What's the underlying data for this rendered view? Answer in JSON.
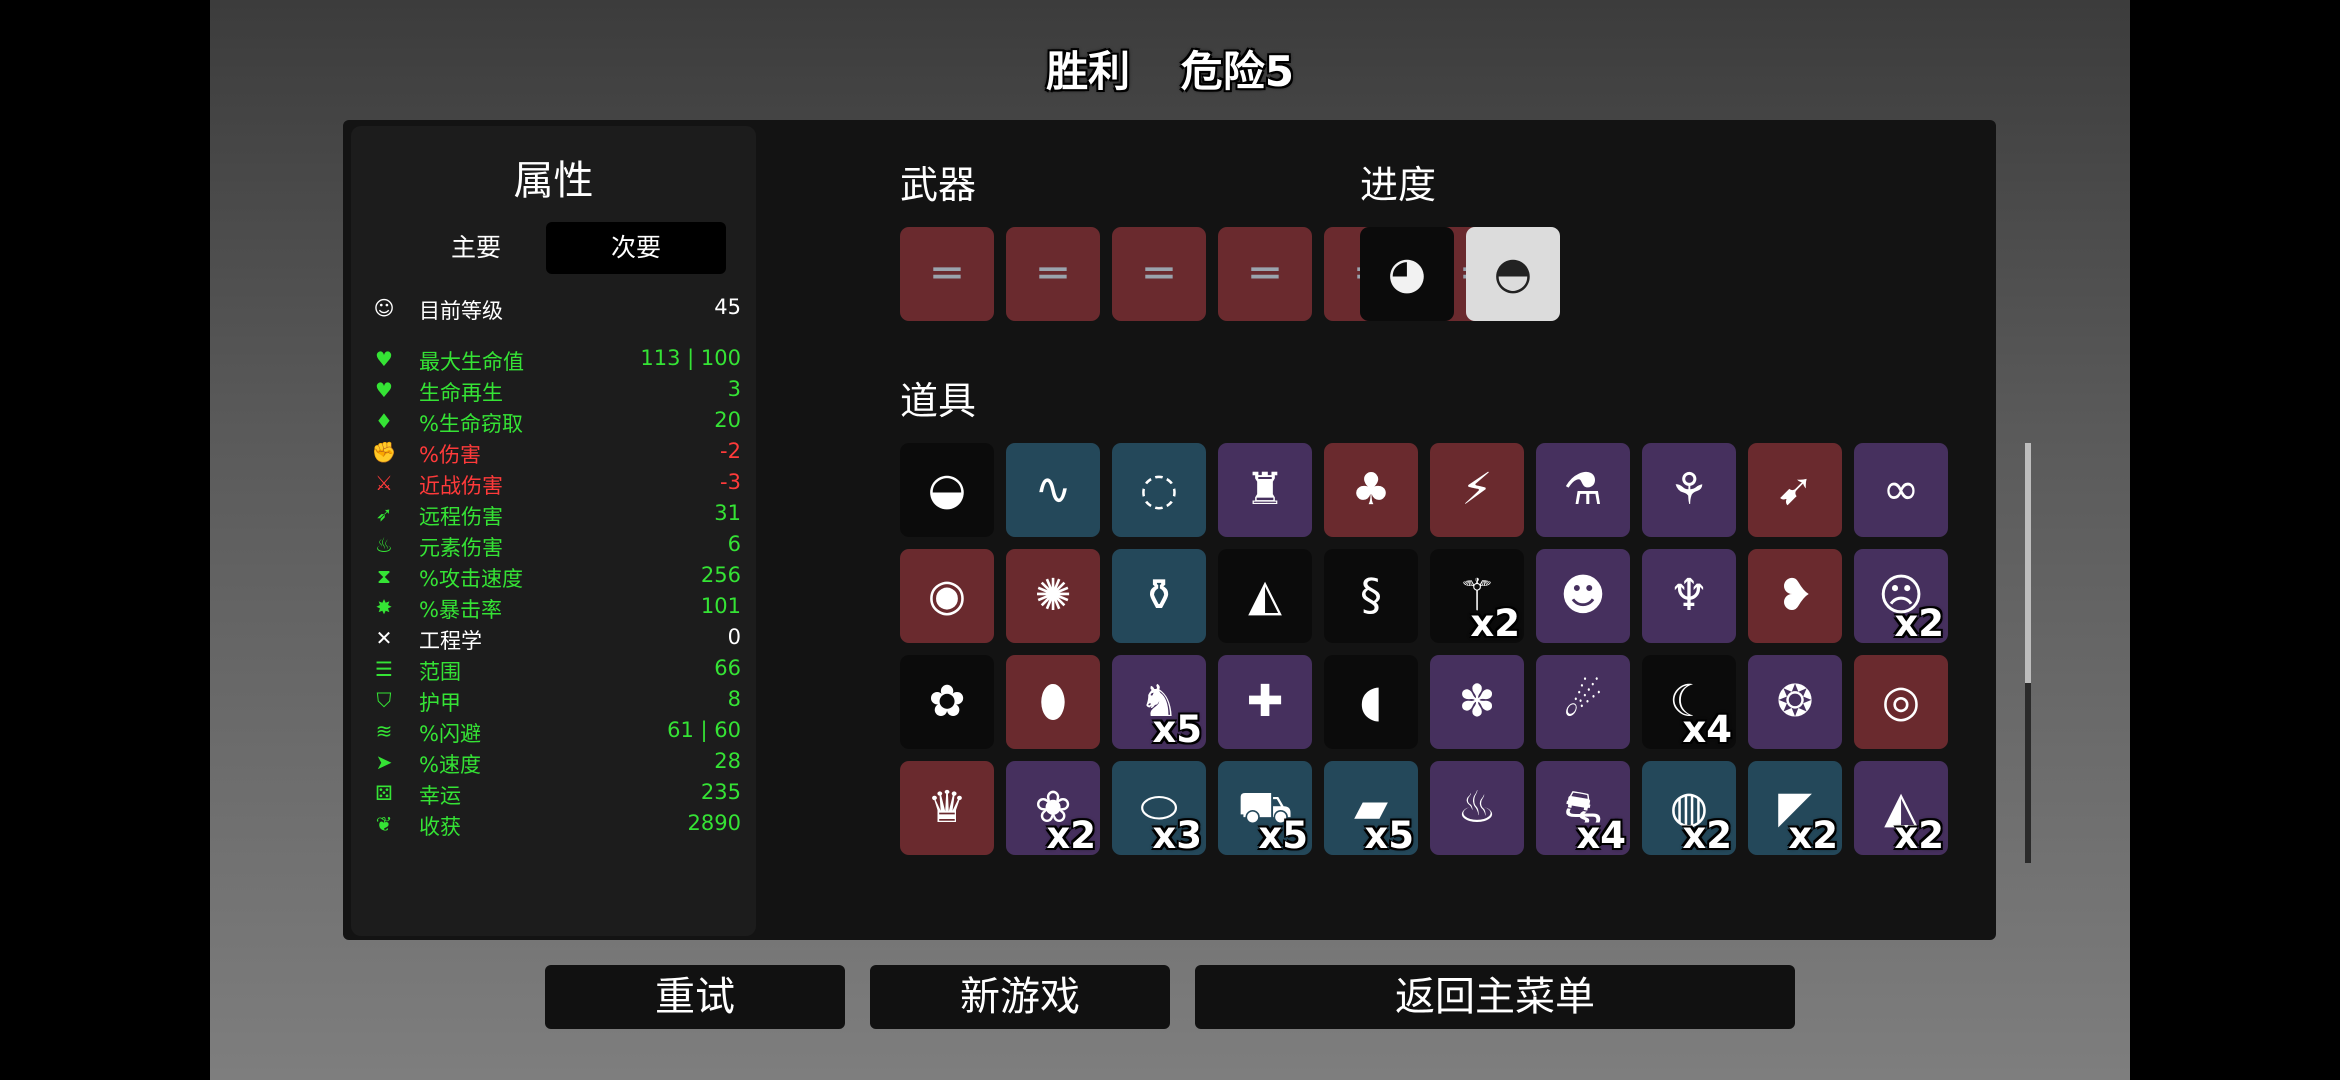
{
  "header": {
    "result": "胜利",
    "difficulty": "危险5"
  },
  "stats_panel": {
    "title": "属性",
    "tabs": [
      {
        "label": "主要",
        "active": false
      },
      {
        "label": "次要",
        "active": true
      }
    ],
    "level": {
      "label": "目前等级",
      "value": "45",
      "icon": "egg-face-icon"
    },
    "rows": [
      {
        "label": "最大生命值",
        "value": "113 | 100",
        "color": "#35e335",
        "icon": "heart-icon",
        "glyph": "♥"
      },
      {
        "label": "生命再生",
        "value": "3",
        "color": "#35e335",
        "icon": "regen-heart-icon",
        "glyph": "♥"
      },
      {
        "label": "%生命窃取",
        "value": "20",
        "color": "#35e335",
        "icon": "fangs-icon",
        "glyph": "♦"
      },
      {
        "label": "%伤害",
        "value": "-2",
        "color": "#ff3a3a",
        "icon": "fist-icon",
        "glyph": "✊"
      },
      {
        "label": "近战伤害",
        "value": "-3",
        "color": "#ff3a3a",
        "icon": "sword-icon",
        "glyph": "⚔"
      },
      {
        "label": "远程伤害",
        "value": "31",
        "color": "#35e335",
        "icon": "bow-icon",
        "glyph": "➶"
      },
      {
        "label": "元素伤害",
        "value": "6",
        "color": "#35e335",
        "icon": "flame-icon",
        "glyph": "♨"
      },
      {
        "label": "%攻击速度",
        "value": "256",
        "color": "#35e335",
        "icon": "hourglass-icon",
        "glyph": "⧗"
      },
      {
        "label": "%暴击率",
        "value": "101",
        "color": "#35e335",
        "icon": "crit-burst-icon",
        "glyph": "✸"
      },
      {
        "label": "工程学",
        "value": "0",
        "color": "#ffffff",
        "icon": "wrench-icon",
        "glyph": "✕"
      },
      {
        "label": "范围",
        "value": "66",
        "color": "#35e335",
        "icon": "range-waves-icon",
        "glyph": "☰"
      },
      {
        "label": "护甲",
        "value": "8",
        "color": "#35e335",
        "icon": "shield-icon",
        "glyph": "⛉"
      },
      {
        "label": "%闪避",
        "value": "61 | 60",
        "color": "#35e335",
        "icon": "dodge-wind-icon",
        "glyph": "≋"
      },
      {
        "label": "%速度",
        "value": "28",
        "color": "#35e335",
        "icon": "boot-icon",
        "glyph": "➤"
      },
      {
        "label": "幸运",
        "value": "235",
        "color": "#35e335",
        "icon": "dice-icon",
        "glyph": "⚄"
      },
      {
        "label": "收获",
        "value": "2890",
        "color": "#35e335",
        "icon": "wheat-icon",
        "glyph": "❦"
      }
    ]
  },
  "weapons": {
    "title": "武器",
    "slots": [
      {
        "icon": "double-barrel-shotgun-icon",
        "glyph": "═",
        "bg": "#6a2a2e"
      },
      {
        "icon": "double-barrel-shotgun-icon",
        "glyph": "═",
        "bg": "#6a2a2e"
      },
      {
        "icon": "double-barrel-shotgun-icon",
        "glyph": "═",
        "bg": "#6a2a2e"
      },
      {
        "icon": "double-barrel-shotgun-icon",
        "glyph": "═",
        "bg": "#6a2a2e"
      },
      {
        "icon": "double-barrel-shotgun-icon",
        "glyph": "═",
        "bg": "#6a2a2e"
      },
      {
        "icon": "double-barrel-shotgun-icon",
        "glyph": "═",
        "bg": "#6a2a2e"
      }
    ]
  },
  "progress": {
    "title": "进度",
    "slots": [
      {
        "icon": "character-mustache-egg-icon",
        "glyph": "◕",
        "bg": "#0b0b0b"
      },
      {
        "icon": "bowler-hat-icon",
        "glyph": "◓",
        "bg": "#dcdcdc"
      }
    ]
  },
  "items": {
    "title": "道具",
    "slots": [
      {
        "icon": "ghost-egg-icon",
        "glyph": "◒",
        "bg": "#0b0b0b",
        "count": ""
      },
      {
        "icon": "worm-icon",
        "glyph": "∿",
        "bg": "#24485a",
        "count": ""
      },
      {
        "icon": "amulet-icon",
        "glyph": "◌",
        "bg": "#24485a",
        "count": ""
      },
      {
        "icon": "baby-bottle-icon",
        "glyph": "♜",
        "bg": "#46305e",
        "count": ""
      },
      {
        "icon": "red-cape-icon",
        "glyph": "♣",
        "bg": "#6a2a2e",
        "count": ""
      },
      {
        "icon": "sword-syringe-icon",
        "glyph": "⚡",
        "bg": "#6a2a2e",
        "count": ""
      },
      {
        "icon": "potion-bundle-icon",
        "glyph": "⚗",
        "bg": "#46305e",
        "count": ""
      },
      {
        "icon": "plant-pot-icon",
        "glyph": "⚘",
        "bg": "#46305e",
        "count": ""
      },
      {
        "icon": "rocket-icon",
        "glyph": "➹",
        "bg": "#6a2a2e",
        "count": ""
      },
      {
        "icon": "handcuffs-icon",
        "glyph": "∞",
        "bg": "#46305e",
        "count": ""
      },
      {
        "icon": "binoculars-icon",
        "glyph": "◉",
        "bg": "#6a2a2e",
        "count": ""
      },
      {
        "icon": "spiked-orb-icon",
        "glyph": "✺",
        "bg": "#6a2a2e",
        "count": ""
      },
      {
        "icon": "flask-icon",
        "glyph": "⚱",
        "bg": "#24485a",
        "count": ""
      },
      {
        "icon": "cake-slice-icon",
        "glyph": "◭",
        "bg": "#0b0b0b",
        "count": ""
      },
      {
        "icon": "red-tentacle-icon",
        "glyph": "§",
        "bg": "#0b0b0b",
        "count": ""
      },
      {
        "icon": "lizard-icon",
        "glyph": "⚚",
        "bg": "#0b0b0b",
        "count": "x2"
      },
      {
        "icon": "bearded-face-icon",
        "glyph": "☻",
        "bg": "#46305e",
        "count": ""
      },
      {
        "icon": "antlers-skull-icon",
        "glyph": "♆",
        "bg": "#46305e",
        "count": ""
      },
      {
        "icon": "stomach-icon",
        "glyph": "❥",
        "bg": "#6a2a2e",
        "count": ""
      },
      {
        "icon": "witch-head-icon",
        "glyph": "☹",
        "bg": "#46305e",
        "count": "x2"
      },
      {
        "icon": "bee-icon",
        "glyph": "✿",
        "bg": "#0b0b0b",
        "count": ""
      },
      {
        "icon": "potato-icon",
        "glyph": "⬮",
        "bg": "#6a2a2e",
        "count": ""
      },
      {
        "icon": "rabbit-icon",
        "glyph": "♞",
        "bg": "#46305e",
        "count": "x5"
      },
      {
        "icon": "blood-syringe-icon",
        "glyph": "✚",
        "bg": "#46305e",
        "count": ""
      },
      {
        "icon": "red-mouth-icon",
        "glyph": "◖",
        "bg": "#0b0b0b",
        "count": ""
      },
      {
        "icon": "brain-creature-icon",
        "glyph": "✽",
        "bg": "#46305e",
        "count": ""
      },
      {
        "icon": "alien-octopus-icon",
        "glyph": "☄",
        "bg": "#46305e",
        "count": ""
      },
      {
        "icon": "scythe-icon",
        "glyph": "☾",
        "bg": "#0b0b0b",
        "count": "x4"
      },
      {
        "icon": "tardigrade-icon",
        "glyph": "❂",
        "bg": "#46305e",
        "count": ""
      },
      {
        "icon": "gold-coin-icon",
        "glyph": "◎",
        "bg": "#6a2a2e",
        "count": ""
      },
      {
        "icon": "dark-helmet-icon",
        "glyph": "♛",
        "bg": "#6a2a2e",
        "count": ""
      },
      {
        "icon": "peacock-icon",
        "glyph": "❀",
        "bg": "#46305e",
        "count": "x2"
      },
      {
        "icon": "capsule-icon",
        "glyph": "⬭",
        "bg": "#24485a",
        "count": "x3"
      },
      {
        "icon": "wheelbarrow-icon",
        "glyph": "⛟",
        "bg": "#24485a",
        "count": "x5"
      },
      {
        "icon": "black-cloth-icon",
        "glyph": "▰",
        "bg": "#24485a",
        "count": "x5"
      },
      {
        "icon": "candle-icon",
        "glyph": "♨",
        "bg": "#46305e",
        "count": ""
      },
      {
        "icon": "tractor-icon",
        "glyph": "⛐",
        "bg": "#46305e",
        "count": "x4"
      },
      {
        "icon": "lifebuoy-icon",
        "glyph": "◍",
        "bg": "#24485a",
        "count": "x2"
      },
      {
        "icon": "horn-cone-icon",
        "glyph": "◤",
        "bg": "#24485a",
        "count": "x2"
      },
      {
        "icon": "triangle-gem-icon",
        "glyph": "◭",
        "bg": "#46305e",
        "count": "x2"
      }
    ]
  },
  "buttons": {
    "retry": "重试",
    "new_game": "新游戏",
    "main_menu": "返回主菜单"
  }
}
